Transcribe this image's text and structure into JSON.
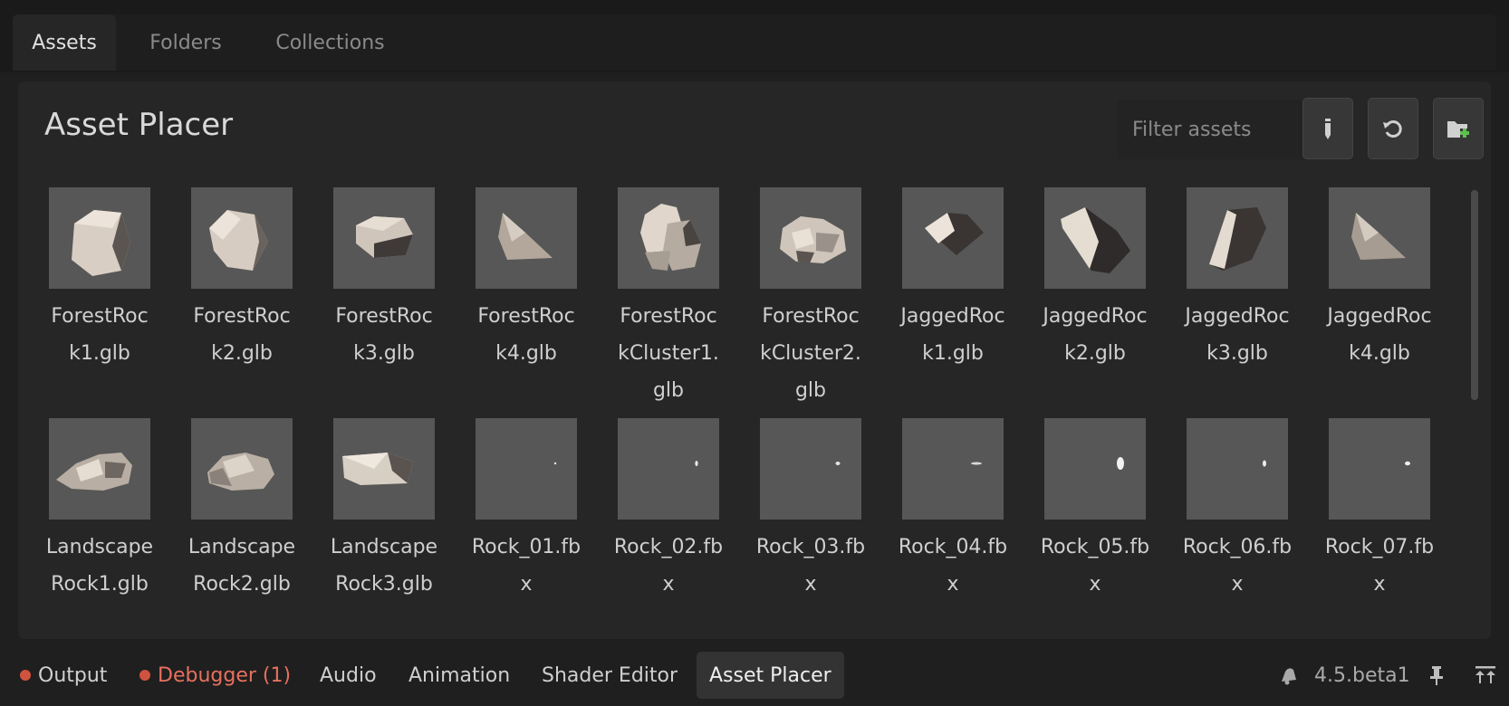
{
  "top_tabs": [
    {
      "label": "Assets",
      "active": true
    },
    {
      "label": "Folders",
      "active": false
    },
    {
      "label": "Collections",
      "active": false
    }
  ],
  "panel": {
    "title": "Asset Placer",
    "filter_placeholder": "Filter assets",
    "buttons": {
      "pencil": "pencil-icon",
      "refresh": "refresh-icon",
      "add_folder": "add-folder-icon"
    }
  },
  "assets": [
    {
      "name": "ForestRock1.glb",
      "label_lines": [
        "ForestRoc",
        "k1.glb"
      ],
      "icon": "rock-thumbnail"
    },
    {
      "name": "ForestRock2.glb",
      "label_lines": [
        "ForestRoc",
        "k2.glb"
      ],
      "icon": "rock-thumbnail"
    },
    {
      "name": "ForestRock3.glb",
      "label_lines": [
        "ForestRoc",
        "k3.glb"
      ],
      "icon": "rock-thumbnail"
    },
    {
      "name": "ForestRock4.glb",
      "label_lines": [
        "ForestRoc",
        "k4.glb"
      ],
      "icon": "rock-thumbnail"
    },
    {
      "name": "ForestRockCluster1.glb",
      "label_lines": [
        "ForestRoc",
        "kCluster1.",
        "glb"
      ],
      "icon": "rock-thumbnail"
    },
    {
      "name": "ForestRockCluster2.glb",
      "label_lines": [
        "ForestRoc",
        "kCluster2.",
        "glb"
      ],
      "icon": "rock-thumbnail"
    },
    {
      "name": "JaggedRock1.glb",
      "label_lines": [
        "JaggedRoc",
        "k1.glb"
      ],
      "icon": "rock-thumbnail"
    },
    {
      "name": "JaggedRock2.glb",
      "label_lines": [
        "JaggedRoc",
        "k2.glb"
      ],
      "icon": "rock-thumbnail"
    },
    {
      "name": "JaggedRock3.glb",
      "label_lines": [
        "JaggedRoc",
        "k3.glb"
      ],
      "icon": "rock-thumbnail"
    },
    {
      "name": "JaggedRock4.glb",
      "label_lines": [
        "JaggedRoc",
        "k4.glb"
      ],
      "icon": "rock-thumbnail"
    },
    {
      "name": "LandscapeRock1.glb",
      "label_lines": [
        "Landscape",
        "Rock1.glb"
      ],
      "icon": "rock-thumbnail"
    },
    {
      "name": "LandscapeRock2.glb",
      "label_lines": [
        "Landscape",
        "Rock2.glb"
      ],
      "icon": "rock-thumbnail"
    },
    {
      "name": "LandscapeRock3.glb",
      "label_lines": [
        "Landscape",
        "Rock3.glb"
      ],
      "icon": "rock-thumbnail"
    },
    {
      "name": "Rock_01.fbx",
      "label_lines": [
        "Rock_01.fb",
        "x"
      ],
      "icon": "tiny-rock-thumbnail"
    },
    {
      "name": "Rock_02.fbx",
      "label_lines": [
        "Rock_02.fb",
        "x"
      ],
      "icon": "tiny-rock-thumbnail"
    },
    {
      "name": "Rock_03.fbx",
      "label_lines": [
        "Rock_03.fb",
        "x"
      ],
      "icon": "tiny-rock-thumbnail"
    },
    {
      "name": "Rock_04.fbx",
      "label_lines": [
        "Rock_04.fb",
        "x"
      ],
      "icon": "tiny-rock-thumbnail"
    },
    {
      "name": "Rock_05.fbx",
      "label_lines": [
        "Rock_05.fb",
        "x"
      ],
      "icon": "tiny-rock-thumbnail"
    },
    {
      "name": "Rock_06.fbx",
      "label_lines": [
        "Rock_06.fb",
        "x"
      ],
      "icon": "tiny-rock-thumbnail"
    },
    {
      "name": "Rock_07.fbx",
      "label_lines": [
        "Rock_07.fb",
        "x"
      ],
      "icon": "tiny-rock-thumbnail"
    }
  ],
  "bottom_tabs": [
    {
      "label": "Output",
      "has_dot": true,
      "color": "#cfcfcf",
      "active": false
    },
    {
      "label": "Debugger (1)",
      "has_dot": true,
      "color": "#e8705e",
      "active": false
    },
    {
      "label": "Audio",
      "has_dot": false,
      "color": "#cfcfcf",
      "active": false
    },
    {
      "label": "Animation",
      "has_dot": false,
      "color": "#cfcfcf",
      "active": false
    },
    {
      "label": "Shader Editor",
      "has_dot": false,
      "color": "#cfcfcf",
      "active": false
    },
    {
      "label": "Asset Placer",
      "has_dot": false,
      "color": "#efefef",
      "active": true
    }
  ],
  "status": {
    "version": "4.5.beta1",
    "icons": [
      "notification-bell-icon",
      "pin-icon",
      "expand-panel-icon"
    ]
  },
  "colors": {
    "background": "#1f1f1f",
    "panel": "#262626",
    "thumbnail": "#575757",
    "error_dot": "#d0533f",
    "add_folder_accent": "#5fbf4f"
  }
}
